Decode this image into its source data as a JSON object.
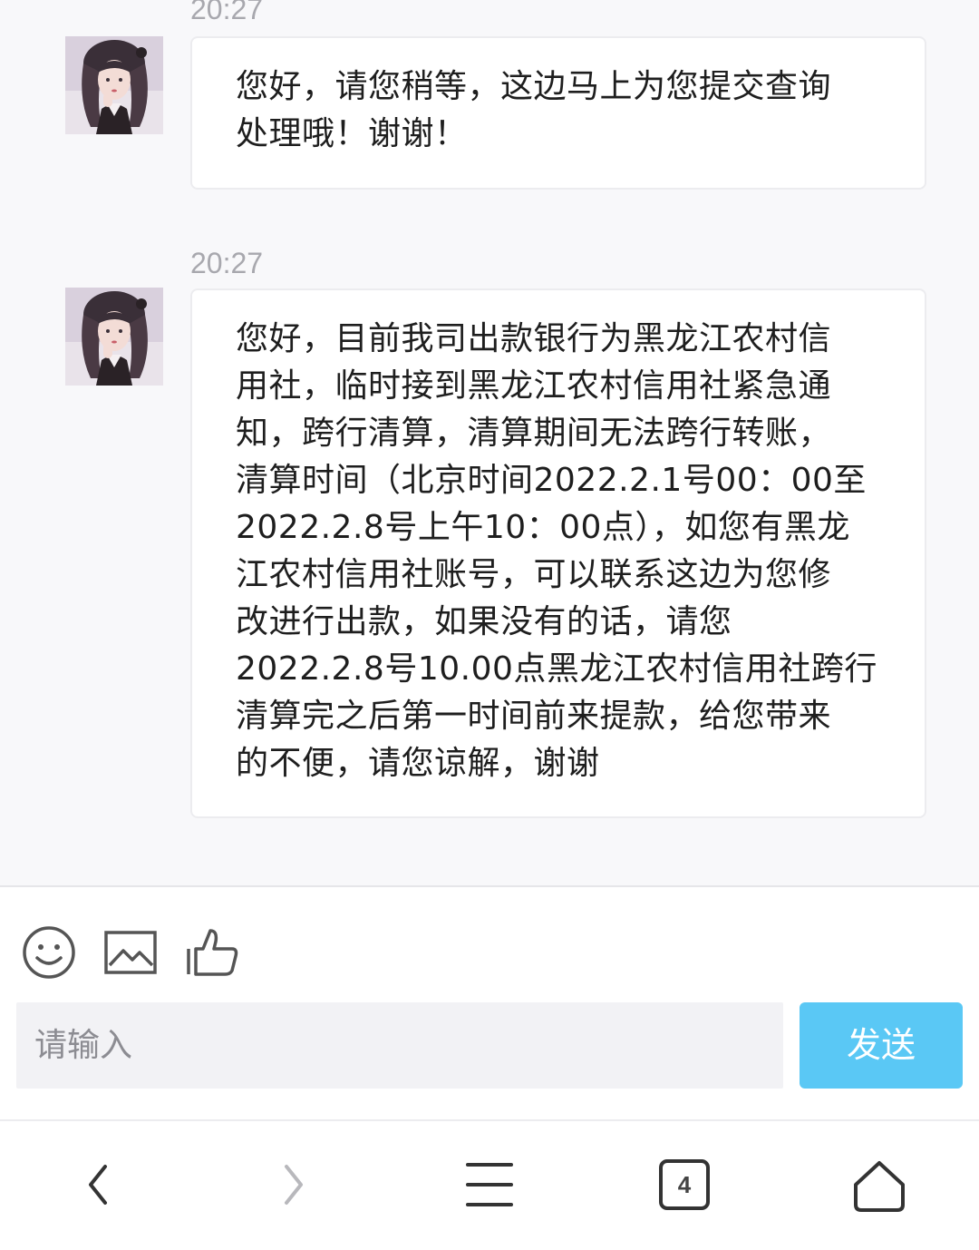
{
  "messages": [
    {
      "time": "20:27",
      "lines": [
        "您好，请您稍等，这边马上为您提交查询",
        "处理哦！谢谢！"
      ]
    },
    {
      "time": "20:27",
      "lines": [
        "您好，目前我司出款银行为黑龙江农村信",
        "用社，临时接到黑龙江农村信用社紧急通",
        "知，跨行清算，清算期间无法跨行转账，",
        "清算时间（北京时间2022.2.1号00：00至",
        "2022.2.8号上午10：00点），如您有黑龙",
        "江农村信用社账号，可以联系这边为您修",
        "改进行出款，如果没有的话，请您",
        "2022.2.8号10.00点黑龙江农村信用社跨行",
        "清算完之后第一时间前来提款，给您带来",
        "的不便，请您谅解，谢谢"
      ]
    }
  ],
  "composer": {
    "placeholder": "请输入",
    "send_label": "发送",
    "tools": [
      "emoji-icon",
      "image-icon",
      "thumbs-up-icon"
    ]
  },
  "navbar": {
    "tab_count": "4",
    "icons": [
      "back-icon",
      "forward-icon",
      "menu-icon",
      "tabs-icon",
      "home-icon"
    ]
  },
  "colors": {
    "send_button": "#5ac8f5",
    "timestamp": "#a8a8ae",
    "background": "#f8f8fa"
  }
}
